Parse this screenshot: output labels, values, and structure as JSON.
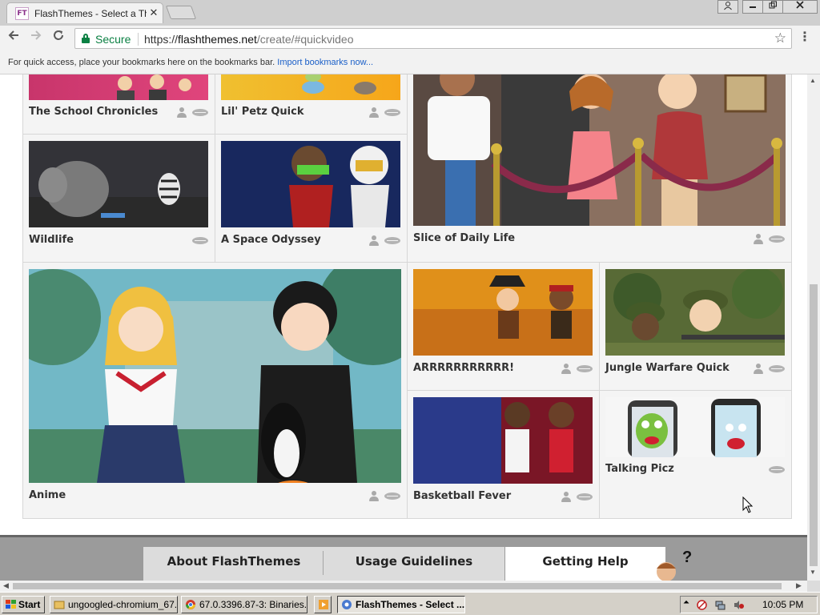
{
  "browser": {
    "tab_title": "FlashThemes - Select a Theme",
    "tab_favicon_text": "FT",
    "tab_close": "✕",
    "secure_label": "Secure",
    "url_scheme": "https://",
    "url_host": "flashthemes.net",
    "url_path": "/create/#quickvideo",
    "bookmarks_hint": "For quick access, place your bookmarks here on the bookmarks bar.",
    "bookmarks_link": "Import bookmarks now..."
  },
  "themes": {
    "school": {
      "title": "The School Chronicles"
    },
    "petz": {
      "title": "Lil' Petz Quick"
    },
    "sliceoflife": {
      "title": "Slice of Daily Life"
    },
    "wildlife": {
      "title": "Wildlife"
    },
    "space": {
      "title": "A Space Odyssey"
    },
    "anime": {
      "title": "Anime"
    },
    "pirate": {
      "title": "ARRRRRRRRRRR!"
    },
    "jungle": {
      "title": "Jungle Warfare Quick"
    },
    "basketball": {
      "title": "Basketball Fever"
    },
    "talking": {
      "title": "Talking Picz"
    }
  },
  "footer": {
    "about": "About FlashThemes",
    "guidelines": "Usage Guidelines",
    "help": "Getting Help",
    "help_mark": "?"
  },
  "taskbar": {
    "start": "Start",
    "item1": "ungoogled-chromium_67...",
    "item2": "67.0.3396.87-3: Binaries...",
    "item3": "FlashThemes - Select ...",
    "clock": "10:05 PM"
  }
}
